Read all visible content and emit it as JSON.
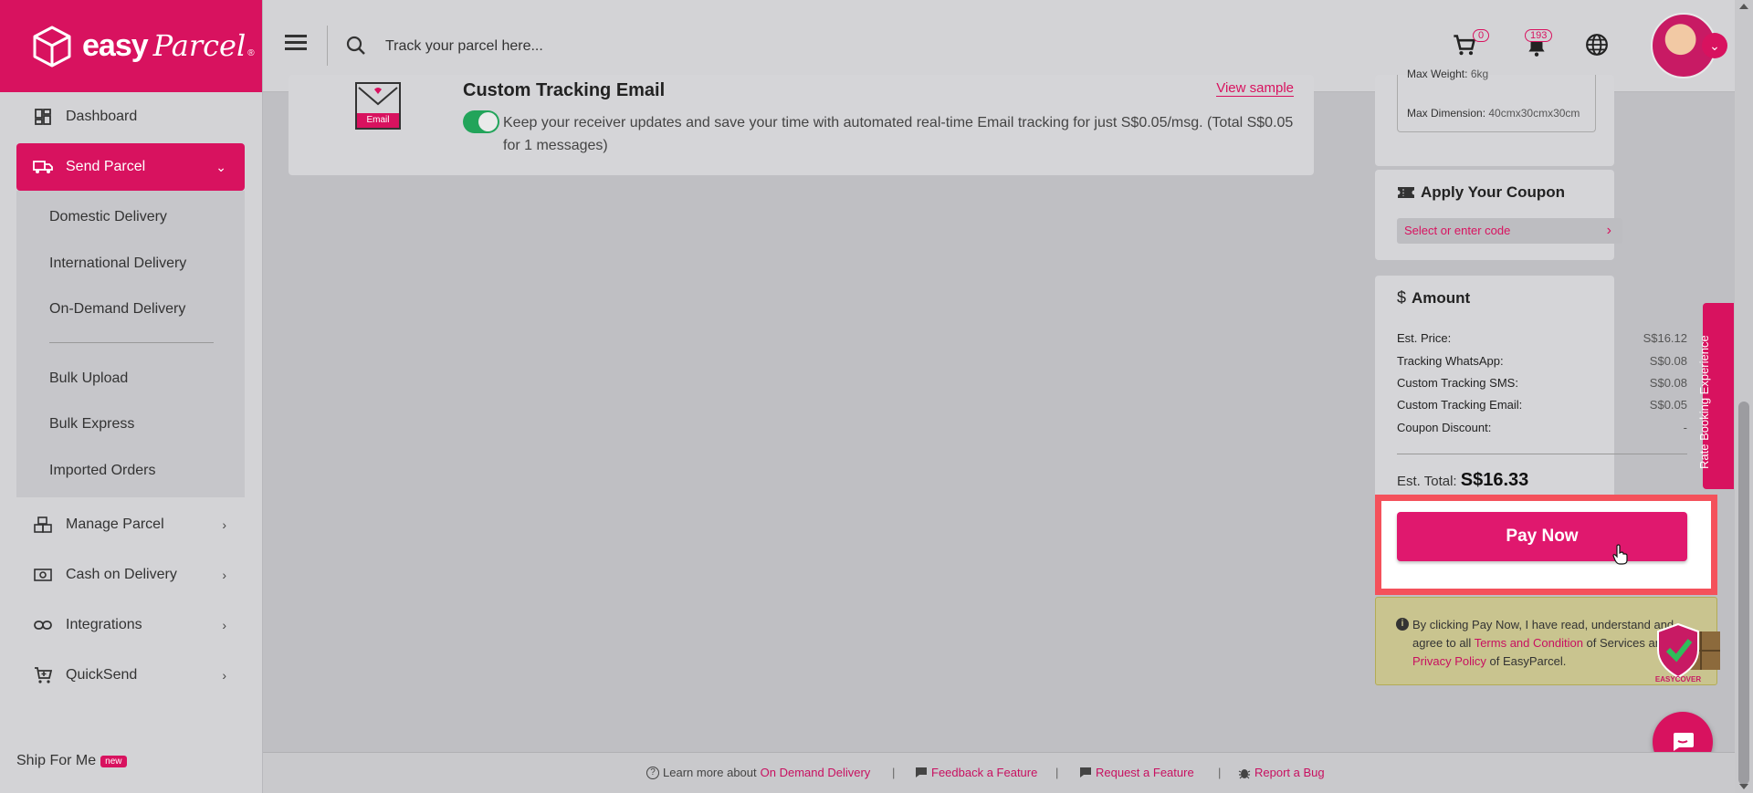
{
  "brand": {
    "name_bold": "easy",
    "name_script": "Parcel",
    "reg": "®"
  },
  "header": {
    "search_placeholder": "Track your parcel here...",
    "cart_count": "0",
    "notification_count": "193"
  },
  "sidebar": {
    "dashboard": "Dashboard",
    "send_parcel": "Send Parcel",
    "sub_items": [
      "Domestic Delivery",
      "International Delivery",
      "On-Demand Delivery",
      "Bulk Upload",
      "Bulk Express",
      "Imported Orders"
    ],
    "manage_parcel": "Manage Parcel",
    "cash_on_delivery": "Cash on Delivery",
    "integrations": "Integrations",
    "quicksend": "QuickSend",
    "ship_for_me": "Ship For Me",
    "new_badge": "new"
  },
  "email_card": {
    "title": "Custom Tracking Email",
    "view_sample": "View sample",
    "icon_label": "Email",
    "description": "Keep your receiver updates and save your time with automated real-time Email tracking for just S$0.05/msg.  (Total S$0.05 for 1 messages)",
    "toggle_on": true
  },
  "parcel_info": {
    "max_weight_label": "Max Weight:",
    "max_weight_value": "6kg",
    "max_dim_label": "Max Dimension:",
    "max_dim_value": "40cmx30cmx30cm"
  },
  "coupon": {
    "title": "Apply Your Coupon",
    "placeholder": "Select or enter code"
  },
  "amount": {
    "title": "Amount",
    "rows": [
      {
        "label": "Est. Price:",
        "value": "S$16.12"
      },
      {
        "label": "Tracking WhatsApp:",
        "value": "S$0.08"
      },
      {
        "label": "Custom Tracking SMS:",
        "value": "S$0.08"
      },
      {
        "label": "Custom Tracking Email:",
        "value": "S$0.05"
      },
      {
        "label": "Coupon Discount:",
        "value": "-"
      }
    ],
    "total_label": "Est. Total:",
    "total_value": "S$16.33"
  },
  "pay_now": "Pay Now",
  "terms": {
    "text1": "By clicking Pay Now, I have read, understand and agree to all ",
    "link1": "Terms and Condition",
    "text2": " of Services and ",
    "link2": "Privacy Policy",
    "text3": " of EasyParcel."
  },
  "shield_label": "EASYCOVER",
  "rate_tab": "Rate Booking Experience",
  "footer": {
    "learn_prefix": "Learn more about ",
    "learn_link": "On Demand Delivery",
    "feedback": "Feedback a Feature",
    "request": "Request a Feature",
    "report": "Report a Bug"
  },
  "colors": {
    "brand": "#d8125f",
    "toggle": "#22a45a",
    "highlight": "#f4515b"
  }
}
